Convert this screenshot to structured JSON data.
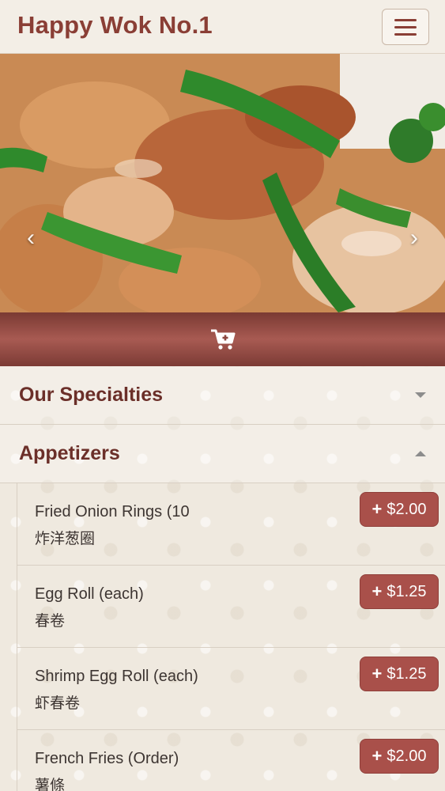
{
  "header": {
    "brand": "Happy Wok No.1",
    "menu_icon": "hamburger-menu-icon"
  },
  "hero": {
    "prev_icon": "chevron-left-icon",
    "next_icon": "chevron-right-icon",
    "slide_count": 4,
    "active_slide": 1
  },
  "cart": {
    "icon": "cart-plus-icon"
  },
  "sections": [
    {
      "title": "Our Specialties",
      "expanded": false
    },
    {
      "title": "Appetizers",
      "expanded": true
    }
  ],
  "items": [
    {
      "name": "Fried Onion Rings (10",
      "name_cn": "炸洋葱圈",
      "price": "$2.00"
    },
    {
      "name": "Egg Roll (each)",
      "name_cn": "春卷",
      "price": "$1.25"
    },
    {
      "name": "Shrimp Egg Roll (each)",
      "name_cn": "虾春卷",
      "price": "$1.25"
    },
    {
      "name": "French Fries (Order)",
      "name_cn": "薯條",
      "price": "$2.00"
    }
  ],
  "colors": {
    "brand": "#8a3e35",
    "button": "#a9504a",
    "bar": "#8d4740",
    "background": "#efe9df"
  }
}
